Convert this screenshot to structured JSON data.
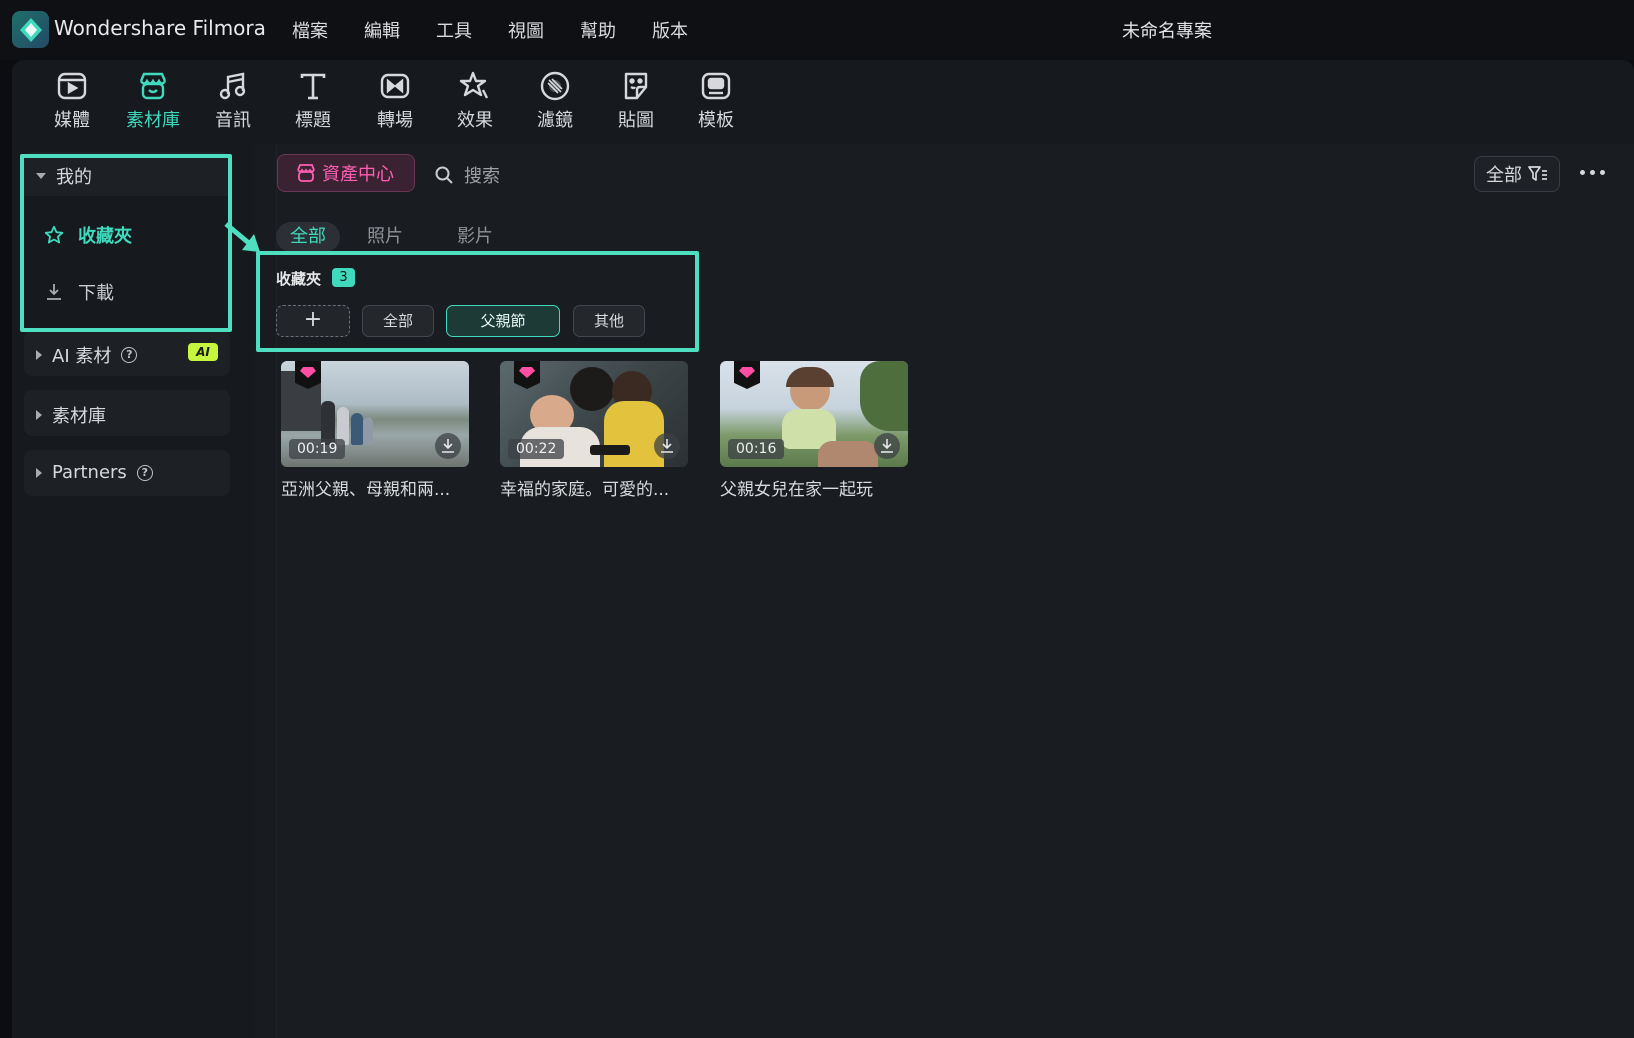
{
  "app": {
    "name": "Wondershare Filmora",
    "project_title": "未命名專案"
  },
  "menu": [
    "檔案",
    "編輯",
    "工具",
    "視圖",
    "幫助",
    "版本"
  ],
  "toolbar": {
    "items": [
      {
        "label": "媒體",
        "icon": "media-icon"
      },
      {
        "label": "素材庫",
        "icon": "stock-store-icon",
        "active": true
      },
      {
        "label": "音訊",
        "icon": "music-note-icon"
      },
      {
        "label": "標題",
        "icon": "text-t-icon"
      },
      {
        "label": "轉場",
        "icon": "transition-icon"
      },
      {
        "label": "效果",
        "icon": "effects-star-icon"
      },
      {
        "label": "濾鏡",
        "icon": "filter-icon"
      },
      {
        "label": "貼圖",
        "icon": "sticker-icon"
      },
      {
        "label": "模板",
        "icon": "template-icon"
      }
    ]
  },
  "sidebar": {
    "mine": {
      "label": "我的",
      "items": [
        {
          "label": "收藏夾",
          "active": true
        },
        {
          "label": "下載"
        }
      ]
    },
    "ai": {
      "label": "AI 素材",
      "badge": "AI"
    },
    "stock": {
      "label": "素材庫"
    },
    "partners": {
      "label": "Partners"
    }
  },
  "content": {
    "asset_center_label": "資產中心",
    "search_placeholder": "搜索",
    "filter_label": "全部",
    "tabs": [
      {
        "label": "全部",
        "active": true
      },
      {
        "label": "照片"
      },
      {
        "label": "影片"
      }
    ],
    "favorites": {
      "label": "收藏夾",
      "count": "3"
    },
    "chips": [
      {
        "label": "+"
      },
      {
        "label": "全部"
      },
      {
        "label": "父親節",
        "active": true
      },
      {
        "label": "其他"
      }
    ],
    "cards": [
      {
        "title": "亞洲父親、母親和兩...",
        "duration": "00:19"
      },
      {
        "title": "幸福的家庭。可愛的...",
        "duration": "00:22"
      },
      {
        "title": "父親女兒在家一起玩",
        "duration": "00:16"
      }
    ]
  },
  "colors": {
    "accent": "#3fd9bd",
    "highlight_border": "#4ddfc0",
    "asset_pink": "#ff5fb3",
    "ai_badge": "#c5f53c"
  }
}
